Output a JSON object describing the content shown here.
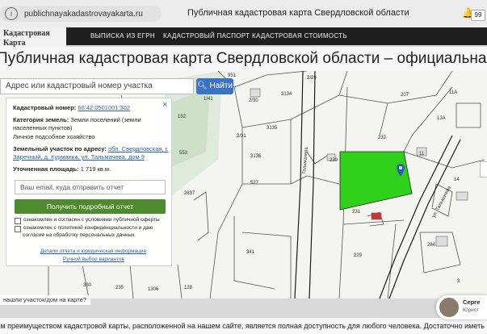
{
  "browser": {
    "url": "publichnayakadastrovayakarta.ru",
    "tab_title": "Публичная кадастровая карта Свердловской области",
    "notification_count": "99"
  },
  "site": {
    "logo_text": "Кадастровая Карта",
    "nav": [
      {
        "label": "ВЫПИСКА ИЗ ЕГРН"
      },
      {
        "label": "КАДАСТРОВЫЙ ПАСПОРТ"
      },
      {
        "label": "КАДАСТРОВАЯ СТОИМОСТЬ"
      }
    ],
    "headline": "Публичная кадастровая карта Свердловской области – официальная информ"
  },
  "search": {
    "placeholder": "Адрес или кадастровый номер участка",
    "button_label": "Найти"
  },
  "info_panel": {
    "close_symbol": "×",
    "cadastral_label": "Кадастровый номер:",
    "cadastral_value": "66:42:0501001:302",
    "category_label": "Категория земель:",
    "category_value_1": "Земли поселений (земли",
    "category_value_2": "населенных пунктов)",
    "use": "Личное подсобное хозяйство",
    "address_label": "Земельный участок по адресу:",
    "address_value_1": "обл. Свердловская, г.",
    "address_value_2": "Заречный, д. Курманка, ул. Тальмачева, дом 9",
    "area_label": "Уточненная площадь:",
    "area_value": "1 719 кв.м.",
    "email_placeholder": "Ваш email, куда отправить отчет",
    "report_button": "Получить подробный отчет",
    "checkbox_offer": "ознакомлен и согласен с условиями публичной оферты",
    "checkbox_privacy_1": "ознакомлен с политикой конфиденциальности и даю",
    "checkbox_privacy_2": "согласие на обработку персональных данных",
    "legal_link": "Детали отчета и юридическая информация",
    "manual_link": "Ручной выбор вариантов"
  },
  "map": {
    "highlight_color": "#2fd11a",
    "parcel_labels": [
      "1/41",
      "2/30",
      "2/31",
      "2/29",
      "3134",
      "3135",
      "3136",
      "152",
      "553",
      "527",
      "2837",
      "239",
      "232",
      "231",
      "207",
      "11А",
      "11",
      "13А",
      "341",
      "229",
      "330",
      "235",
      "1306",
      "128",
      "284",
      "3",
      "951",
      "14"
    ],
    "street_labels": [
      "ул. Тальмачева",
      "Тальмачева"
    ]
  },
  "ribbon_text": "нашли участок/дом на карте?",
  "bottom_text": "ым преимуществом кадастровой карты, расположенной на нашем сайте, является полная доступность для любого человека. Достаточно иметь компьютер",
  "chat": {
    "name": "Серге",
    "role": "Юрист"
  }
}
